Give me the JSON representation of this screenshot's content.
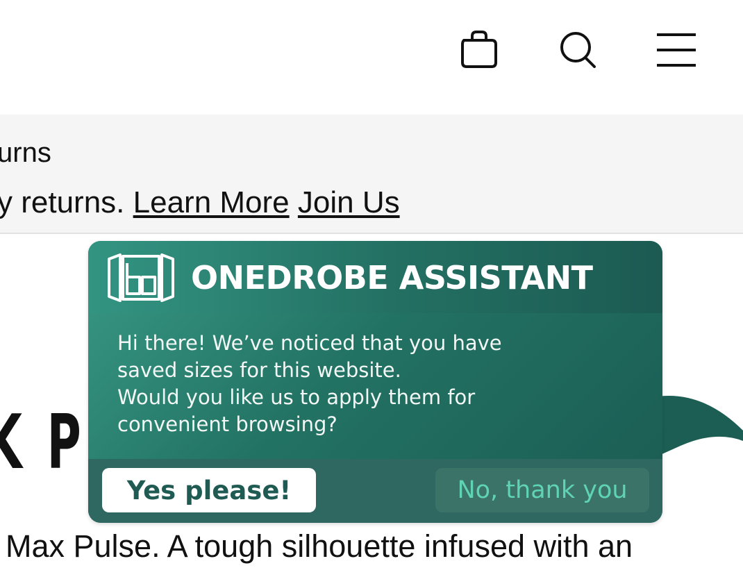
{
  "header": {
    "icons": [
      "shopping-bag-icon",
      "search-icon",
      "menu-icon"
    ]
  },
  "banner": {
    "line1": "urns",
    "line2_prefix": "y returns. ",
    "learn_more": "Learn More",
    "join_us": "Join Us"
  },
  "product": {
    "title_fragment": "K P",
    "description": "Max Pulse. A tough silhouette infused with an"
  },
  "popup": {
    "title": "ONEDROBE ASSISTANT",
    "logo_icon": "wardrobe-icon",
    "message_lines": [
      "Hi there! We’ve noticed that you have",
      "saved sizes for this website.",
      "Would you like us to apply them for",
      "convenient browsing?"
    ],
    "yes_label": "Yes please!",
    "no_label": "No, thank you"
  },
  "colors": {
    "popup_teal": "#227263",
    "popup_teal_dark": "#1b5b52",
    "yes_text": "#1f5b52",
    "no_text": "#5fd3b4"
  }
}
